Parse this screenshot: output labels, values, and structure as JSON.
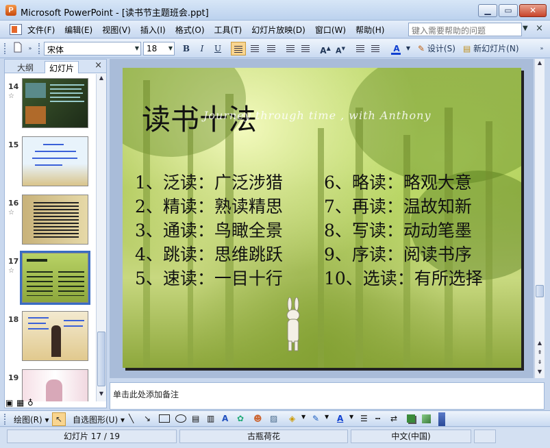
{
  "window": {
    "title": "Microsoft PowerPoint - [读书节主题班会.ppt]",
    "min_glyph": "▁",
    "max_glyph": "▭",
    "close_glyph": "✕"
  },
  "menu": {
    "items": [
      "文件(F)",
      "编辑(E)",
      "视图(V)",
      "插入(I)",
      "格式(O)",
      "工具(T)",
      "幻灯片放映(D)",
      "窗口(W)",
      "帮助(H)"
    ],
    "help_placeholder": "键入需要帮助的问题",
    "doc_close": "×"
  },
  "toolbar": {
    "font_name": "宋体",
    "font_size": "18",
    "bold": "B",
    "italic": "I",
    "underline": "U",
    "grow_font": "A",
    "shrink_font": "A",
    "font_color": "A",
    "design_label": "设计(S)",
    "new_slide_label": "新幻灯片(N)"
  },
  "left_panel": {
    "tab_outline": "大纲",
    "tab_slides": "幻灯片",
    "close": "×",
    "star": "☆",
    "thumbnails": [
      {
        "number": "14",
        "has_star": true
      },
      {
        "number": "15",
        "has_star": false
      },
      {
        "number": "16",
        "has_star": true
      },
      {
        "number": "17",
        "has_star": true,
        "selected": true
      },
      {
        "number": "18",
        "has_star": false
      },
      {
        "number": "19",
        "has_star": false
      }
    ]
  },
  "slide": {
    "title": "读书十法",
    "script_text": "Journey through time , with Anthony",
    "left_column": [
      "1、泛读：广泛涉猎",
      "2、精读：熟读精思",
      "3、通读：鸟瞰全景",
      "4、跳读：思维跳跃",
      "5、速读：一目十行"
    ],
    "right_column": [
      "6、略读：略观大意",
      "7、再读：温故知新",
      "8、写读：动动笔墨",
      "9、序读：阅读书序",
      "10、选读：有所选择"
    ]
  },
  "notes": {
    "placeholder": "单击此处添加备注"
  },
  "drawing_toolbar": {
    "draw_label": "绘图(R)",
    "autoshapes_label": "自选图形(U)"
  },
  "status_bar": {
    "slide_info": "幻灯片 17 / 19",
    "design_name": "古瓶荷花",
    "language": "中文(中国)"
  },
  "colors": {
    "accent": "#3a6cc2",
    "title_bar": "#bcd2ee",
    "slide_green": "#a6c24c"
  }
}
